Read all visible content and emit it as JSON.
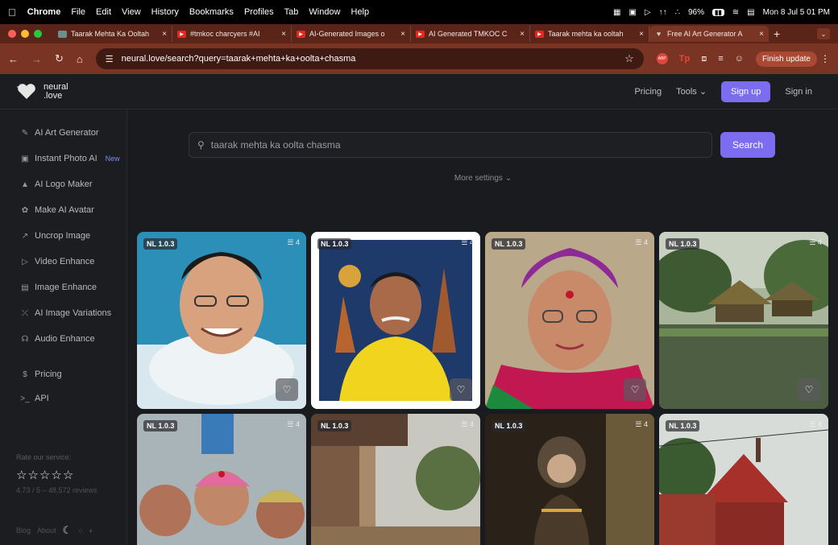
{
  "menubar": {
    "app": "Chrome",
    "menus": [
      "File",
      "Edit",
      "View",
      "History",
      "Bookmarks",
      "Profiles",
      "Tab",
      "Window",
      "Help"
    ],
    "battery": "96%",
    "clock": "Mon 8 Jul  5 01 PM"
  },
  "tabs": [
    {
      "title": "Taarak Mehta Ka Ooltah"
    },
    {
      "title": "#tmkoc charcyers #AI"
    },
    {
      "title": "AI-Generated Images o"
    },
    {
      "title": "AI Generated TMKOC C"
    },
    {
      "title": "Taarak mehta ka ooltah"
    },
    {
      "title": "Free AI Art Generator A"
    }
  ],
  "address": {
    "url": "neural.love/search?query=taarak+mehta+ka+oolta+chasma",
    "update_label": "Finish update"
  },
  "site": {
    "logo_line1": "neural",
    "logo_line2": ".love",
    "nav": {
      "pricing": "Pricing",
      "tools": "Tools",
      "signup": "Sign up",
      "signin": "Sign in"
    }
  },
  "sidebar": {
    "items": [
      {
        "label": "AI Art Generator",
        "icon": "brush-icon"
      },
      {
        "label": "Instant Photo AI",
        "icon": "camera-icon",
        "badge": "New"
      },
      {
        "label": "AI Logo Maker",
        "icon": "logo-icon"
      },
      {
        "label": "Make AI Avatar",
        "icon": "avatar-icon"
      },
      {
        "label": "Uncrop Image",
        "icon": "expand-icon"
      },
      {
        "label": "Video Enhance",
        "icon": "play-icon"
      },
      {
        "label": "Image Enhance",
        "icon": "image-icon"
      },
      {
        "label": "AI Image Variations",
        "icon": "shuffle-icon"
      },
      {
        "label": "Audio Enhance",
        "icon": "headphones-icon"
      },
      {
        "label": "Pricing",
        "icon": "dollar-icon"
      },
      {
        "label": "API",
        "icon": "terminal-icon"
      }
    ],
    "rate_label": "Rate our service:",
    "reviews": "4.73 / 5 – 48,572 reviews",
    "footer": {
      "blog": "Blog",
      "about": "About"
    }
  },
  "search": {
    "value": "taarak mehta ka oolta chasma",
    "button": "Search",
    "more_settings": "More settings"
  },
  "results": [
    {
      "badge": "NL 1.0.3",
      "count": "4",
      "subject": "smiling man with white scarf"
    },
    {
      "badge": "NL 1.0.3",
      "count": "4",
      "subject": "man in yellow shirt with palace"
    },
    {
      "badge": "NL 1.0.3",
      "count": "4",
      "subject": "woman with purple turban"
    },
    {
      "badge": "NL 1.0.3",
      "count": "4",
      "subject": "village huts by a pond"
    },
    {
      "badge": "NL 1.0.3",
      "count": "4",
      "subject": "group of laughing women"
    },
    {
      "badge": "NL 1.0.3",
      "count": "4",
      "subject": "rural house with trees"
    },
    {
      "badge": "NL 1.0.3",
      "count": "4",
      "subject": "monkey in golden ornaments"
    },
    {
      "badge": "NL 1.0.3",
      "count": "4",
      "subject": "red temple roof"
    }
  ]
}
